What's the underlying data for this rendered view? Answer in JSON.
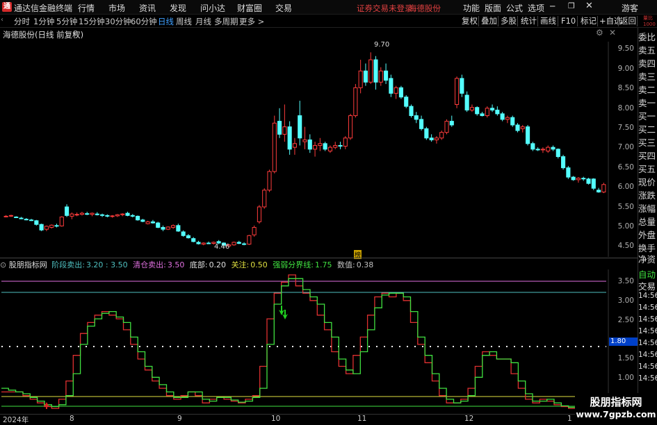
{
  "app": {
    "logo": "通",
    "title": "通达信金融终端",
    "status": "证券交易未登录",
    "stock": "海德股份",
    "guest": "游客"
  },
  "menu": [
    "行情",
    "市场",
    "资讯",
    "发现",
    "问小达",
    "财富圈",
    "交易"
  ],
  "menu_right": [
    "功能",
    "版面",
    "公式",
    "选项"
  ],
  "periods": [
    "分时",
    "1分钟",
    "5分钟",
    "15分钟",
    "30分钟",
    "60分钟",
    "日线",
    "周线",
    "月线",
    "多周期",
    "更多 >"
  ],
  "active_period": "日线",
  "toolbar": [
    "复权",
    "叠加",
    "多股",
    "统计",
    "画线",
    "F10",
    "标记",
    "+自选",
    "返回"
  ],
  "main": {
    "title": "海德股份(日线 前复权)",
    "high_label": "9.70",
    "low_label": "4.46",
    "marker_label": "榜"
  },
  "right_sidebar": [
    "委比",
    "卖五",
    "卖四",
    "卖三",
    "卖二",
    "卖一",
    "买一",
    "买二",
    "买三",
    "买四",
    "买五",
    "现价",
    "涨跌",
    "涨幅",
    "总量",
    "外盘",
    "换手",
    "净资",
    "收益"
  ],
  "top_right_tiny": {
    "a": "量比",
    "b": "1000"
  },
  "main_y_labels": [
    "9.50",
    "9.00",
    "8.50",
    "8.00",
    "7.50",
    "7.00",
    "6.50",
    "6.00",
    "5.50",
    "5.00",
    "4.50"
  ],
  "indicator": {
    "name": "股朋指标网",
    "params": [
      {
        "label": "阶段卖出:",
        "value": "3.20 : 3.50",
        "color": "#4fc0c0"
      },
      {
        "label": "清仓卖出:",
        "value": "3.50",
        "color": "#e070e0"
      },
      {
        "label": "底部:",
        "value": "0.20",
        "color": "#e0e0e0"
      },
      {
        "label": "关注:",
        "value": "0.50",
        "color": "#e0e040"
      },
      {
        "label": "强弱分界线:",
        "value": "1.75",
        "color": "#40e040"
      },
      {
        "label": "数值:",
        "value": "0.38",
        "color": "#c0c0c0"
      }
    ],
    "y_labels": [
      "3.50",
      "3.00",
      "2.50",
      "1.80",
      "1.50",
      "1.00",
      "0.50"
    ],
    "current_value": "1.80"
  },
  "ind_right": {
    "a": "自动",
    "b": "交易",
    "times": [
      "14:56",
      "14:56",
      "14:56",
      "14:56",
      "14:56",
      "14:56",
      "14:56",
      "14:56"
    ]
  },
  "dates": [
    "2024年",
    "8",
    "9",
    "10",
    "11",
    "12",
    "1"
  ],
  "watermark": {
    "line1": "股朋指标网",
    "line2": "www.7gpzb.com"
  },
  "chart_data": [
    {
      "type": "candlestick",
      "ylim": [
        4.3,
        9.8
      ],
      "ohlc": [
        [
          5.3,
          5.33,
          5.27,
          5.3
        ],
        [
          5.31,
          5.34,
          5.28,
          5.32
        ],
        [
          5.28,
          5.3,
          5.25,
          5.27
        ],
        [
          5.25,
          5.28,
          5.22,
          5.24
        ],
        [
          5.22,
          5.25,
          5.19,
          5.21
        ],
        [
          5.2,
          5.23,
          5.17,
          5.19
        ],
        [
          5.18,
          5.2,
          5.05,
          5.08
        ],
        [
          5.08,
          5.1,
          4.9,
          4.93
        ],
        [
          4.95,
          5.05,
          4.9,
          5.03
        ],
        [
          5.0,
          5.08,
          4.97,
          5.06
        ],
        [
          5.05,
          5.1,
          5.0,
          5.04
        ],
        [
          5.04,
          5.3,
          5.02,
          5.28
        ],
        [
          5.55,
          5.62,
          5.28,
          5.32
        ],
        [
          5.3,
          5.4,
          5.22,
          5.36
        ],
        [
          5.34,
          5.4,
          5.3,
          5.35
        ],
        [
          5.35,
          5.42,
          5.32,
          5.38
        ],
        [
          5.37,
          5.42,
          5.33,
          5.35
        ],
        [
          5.35,
          5.4,
          5.3,
          5.38
        ],
        [
          5.36,
          5.41,
          5.32,
          5.34
        ],
        [
          5.34,
          5.37,
          5.28,
          5.32
        ],
        [
          5.32,
          5.35,
          5.27,
          5.3
        ],
        [
          5.3,
          5.33,
          5.26,
          5.31
        ],
        [
          5.31,
          5.36,
          5.28,
          5.34
        ],
        [
          5.34,
          5.38,
          5.3,
          5.36
        ],
        [
          5.38,
          5.42,
          5.3,
          5.32
        ],
        [
          5.32,
          5.36,
          5.27,
          5.3
        ],
        [
          5.3,
          5.32,
          5.18,
          5.2
        ],
        [
          5.2,
          5.23,
          5.14,
          5.16
        ],
        [
          5.1,
          5.18,
          5.08,
          5.15
        ],
        [
          5.15,
          5.2,
          5.1,
          5.12
        ],
        [
          5.12,
          5.15,
          4.98,
          5.0
        ],
        [
          5.0,
          5.05,
          4.9,
          4.95
        ],
        [
          4.95,
          5.03,
          4.93,
          5.01
        ],
        [
          5.0,
          5.08,
          4.96,
          5.05
        ],
        [
          5.05,
          5.1,
          4.88,
          4.9
        ],
        [
          4.88,
          4.92,
          4.75,
          4.78
        ],
        [
          4.78,
          4.82,
          4.7,
          4.72
        ],
        [
          4.7,
          4.74,
          4.6,
          4.62
        ],
        [
          4.6,
          4.64,
          4.54,
          4.56
        ],
        [
          4.55,
          4.6,
          4.52,
          4.58
        ],
        [
          4.58,
          4.62,
          4.55,
          4.57
        ],
        [
          4.57,
          4.62,
          4.54,
          4.6
        ],
        [
          4.62,
          4.66,
          4.55,
          4.58
        ],
        [
          4.58,
          4.6,
          4.5,
          4.52
        ],
        [
          4.5,
          4.55,
          4.46,
          4.53
        ],
        [
          4.53,
          4.62,
          4.51,
          4.6
        ],
        [
          4.6,
          4.64,
          4.55,
          4.57
        ],
        [
          4.56,
          4.6,
          4.52,
          4.55
        ],
        [
          4.55,
          4.8,
          4.53,
          4.78
        ],
        [
          4.8,
          5.05,
          4.75,
          5.0
        ],
        [
          5.15,
          5.6,
          5.1,
          5.55
        ],
        [
          5.55,
          6.05,
          5.5,
          6.0
        ],
        [
          6.0,
          6.55,
          5.95,
          6.5
        ],
        [
          6.5,
          8.0,
          6.45,
          7.8
        ],
        [
          7.85,
          8.2,
          7.4,
          7.5
        ],
        [
          7.5,
          8.3,
          7.3,
          7.7
        ],
        [
          7.7,
          7.85,
          6.95,
          7.1
        ],
        [
          7.15,
          7.4,
          6.95,
          7.25
        ],
        [
          8.0,
          8.4,
          7.2,
          7.4
        ],
        [
          7.3,
          7.7,
          7.1,
          7.35
        ],
        [
          7.35,
          7.5,
          7.0,
          7.1
        ],
        [
          7.1,
          7.3,
          6.9,
          7.2
        ],
        [
          7.2,
          7.4,
          7.05,
          7.25
        ],
        [
          7.25,
          7.3,
          7.05,
          7.1
        ],
        [
          7.05,
          7.2,
          7.0,
          7.15
        ],
        [
          7.15,
          7.3,
          7.1,
          7.2
        ],
        [
          7.2,
          7.3,
          7.1,
          7.18
        ],
        [
          7.18,
          7.45,
          7.1,
          7.4
        ],
        [
          7.4,
          8.05,
          7.35,
          8.0
        ],
        [
          8.0,
          8.85,
          7.95,
          8.75
        ],
        [
          8.75,
          9.5,
          8.6,
          9.2
        ],
        [
          9.2,
          9.4,
          8.8,
          8.9
        ],
        [
          8.9,
          9.7,
          8.85,
          9.5
        ],
        [
          9.5,
          9.6,
          8.7,
          8.9
        ],
        [
          8.9,
          9.3,
          8.8,
          9.2
        ],
        [
          9.2,
          9.4,
          8.85,
          8.95
        ],
        [
          9.0,
          9.1,
          8.5,
          8.6
        ],
        [
          8.6,
          8.8,
          8.45,
          8.75
        ],
        [
          8.75,
          8.8,
          8.45,
          8.5
        ],
        [
          8.5,
          8.55,
          8.2,
          8.25
        ],
        [
          8.25,
          8.3,
          7.95,
          8.0
        ],
        [
          8.0,
          8.1,
          7.8,
          7.9
        ],
        [
          7.9,
          8.0,
          7.6,
          7.65
        ],
        [
          7.65,
          7.7,
          7.35,
          7.4
        ],
        [
          7.4,
          7.5,
          7.3,
          7.35
        ],
        [
          7.35,
          7.45,
          7.25,
          7.4
        ],
        [
          7.4,
          7.6,
          7.35,
          7.55
        ],
        [
          7.55,
          7.9,
          7.5,
          7.85
        ],
        [
          7.85,
          8.0,
          7.7,
          7.75
        ],
        [
          8.3,
          9.05,
          8.2,
          9.0
        ],
        [
          9.0,
          9.1,
          8.5,
          8.6
        ],
        [
          8.55,
          8.65,
          8.1,
          8.15
        ],
        [
          8.15,
          8.3,
          8.1,
          8.22
        ],
        [
          8.22,
          8.25,
          8.0,
          8.05
        ],
        [
          8.05,
          8.1,
          7.98,
          8.0
        ],
        [
          8.0,
          8.25,
          7.95,
          8.2
        ],
        [
          8.2,
          8.3,
          8.1,
          8.15
        ],
        [
          8.15,
          8.25,
          8.0,
          8.05
        ],
        [
          8.05,
          8.1,
          7.85,
          7.9
        ],
        [
          7.9,
          8.0,
          7.8,
          7.95
        ],
        [
          7.95,
          8.0,
          7.7,
          7.75
        ],
        [
          7.75,
          7.8,
          7.55,
          7.6
        ],
        [
          7.65,
          7.75,
          7.55,
          7.7
        ],
        [
          7.7,
          7.75,
          7.2,
          7.25
        ],
        [
          7.25,
          7.3,
          7.05,
          7.1
        ],
        [
          7.1,
          7.15,
          7.05,
          7.08
        ],
        [
          7.08,
          7.15,
          7.0,
          7.1
        ],
        [
          7.05,
          7.2,
          7.0,
          7.15
        ],
        [
          7.15,
          7.2,
          7.05,
          7.1
        ],
        [
          7.1,
          7.12,
          6.85,
          6.9
        ],
        [
          6.9,
          6.95,
          6.55,
          6.6
        ],
        [
          6.6,
          6.65,
          6.3,
          6.35
        ],
        [
          6.35,
          6.38,
          6.25,
          6.28
        ],
        [
          6.28,
          6.35,
          6.2,
          6.32
        ],
        [
          6.32,
          6.36,
          6.25,
          6.3
        ],
        [
          6.3,
          6.33,
          6.15,
          6.18
        ],
        [
          6.3,
          6.32,
          6.0,
          6.05
        ],
        [
          6.0,
          6.06,
          5.93,
          5.95
        ],
        [
          5.95,
          6.2,
          5.92,
          6.15
        ]
      ]
    },
    {
      "type": "line",
      "ylim": [
        -0.1,
        3.85
      ],
      "series": [
        {
          "name": "股朋指标网",
          "values": [
            0.5,
            0.5,
            0.5,
            0.4,
            0.3,
            0.2,
            0.1,
            0.05,
            0.3,
            0.8,
            1.5,
            2.1,
            2.4,
            2.6,
            2.7,
            2.6,
            2.5,
            2.2,
            1.8,
            1.4,
            1.1,
            0.8,
            0.6,
            0.4,
            0.3,
            0.4,
            0.5,
            0.4,
            0.2,
            0.3,
            0.35,
            0.3,
            0.25,
            0.2,
            0.3,
            0.4,
            1.2,
            2.5,
            3.2,
            3.5,
            3.7,
            3.4,
            3.2,
            3.0,
            2.6,
            2.2,
            1.6,
            1.2,
            1.0,
            1.5,
            2.0,
            2.6,
            3.1,
            3.2,
            3.1,
            3.2,
            3.0,
            2.4,
            1.8,
            1.3,
            0.8,
            0.4,
            0.2,
            0.2,
            0.3,
            0.6,
            1.2,
            1.6,
            1.5,
            1.4,
            1.4,
            1.0,
            0.6,
            0.3,
            0.2,
            0.3,
            0.25,
            0.15,
            0.1,
            0.05
          ]
        },
        {
          "name": "强弱分界线",
          "values": [
            0.6,
            0.55,
            0.5,
            0.45,
            0.35,
            0.25,
            0.15,
            0.1,
            0.15,
            0.4,
            1.0,
            1.8,
            2.3,
            2.5,
            2.65,
            2.7,
            2.55,
            2.4,
            2.0,
            1.6,
            1.2,
            0.9,
            0.7,
            0.5,
            0.35,
            0.35,
            0.5,
            0.5,
            0.3,
            0.25,
            0.35,
            0.35,
            0.28,
            0.22,
            0.25,
            0.35,
            0.6,
            1.8,
            2.9,
            3.4,
            3.6,
            3.6,
            3.3,
            3.1,
            2.9,
            2.4,
            2.0,
            1.4,
            1.1,
            1.0,
            1.6,
            2.2,
            2.8,
            3.15,
            3.2,
            3.2,
            3.1,
            2.7,
            2.0,
            1.5,
            1.0,
            0.6,
            0.3,
            0.2,
            0.25,
            0.4,
            0.9,
            1.5,
            1.6,
            1.4,
            1.4,
            1.3,
            0.8,
            0.45,
            0.25,
            0.25,
            0.3,
            0.2,
            0.12,
            0.08
          ]
        }
      ]
    }
  ]
}
